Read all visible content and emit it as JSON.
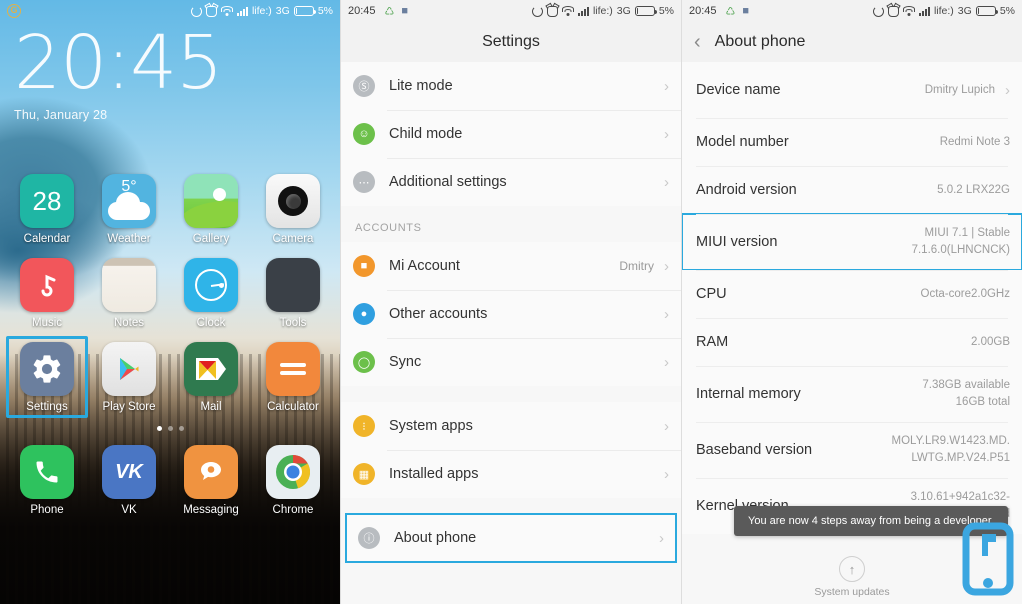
{
  "status_bar": {
    "time": "20:45",
    "carrier": "life:)",
    "network": "3G",
    "battery": "5%",
    "icons": [
      "sync-icon",
      "alarm-icon",
      "wifi-icon",
      "signal-icon",
      "battery-icon"
    ],
    "left_icons_home": [
      "g-badge-icon"
    ],
    "left_icons_settings": [
      "sync-small-icon",
      "screenshot-icon"
    ]
  },
  "home": {
    "clock": "20:45",
    "date": "Thu, January 28",
    "rows": [
      [
        {
          "label": "Calendar",
          "icon": "calendar-icon",
          "badge": "28"
        },
        {
          "label": "Weather",
          "icon": "weather-icon",
          "temp": "5°"
        },
        {
          "label": "Gallery",
          "icon": "gallery-icon"
        },
        {
          "label": "Camera",
          "icon": "camera-icon"
        }
      ],
      [
        {
          "label": "Music",
          "icon": "music-icon"
        },
        {
          "label": "Notes",
          "icon": "notes-icon"
        },
        {
          "label": "Clock",
          "icon": "clock-icon"
        },
        {
          "label": "Tools",
          "icon": "tools-folder-icon"
        }
      ],
      [
        {
          "label": "Settings",
          "icon": "settings-gear-icon",
          "selected": true
        },
        {
          "label": "Play Store",
          "icon": "play-store-icon"
        },
        {
          "label": "Mail",
          "icon": "mail-icon"
        },
        {
          "label": "Calculator",
          "icon": "calculator-icon"
        }
      ]
    ],
    "dock": [
      {
        "label": "Phone",
        "icon": "phone-icon"
      },
      {
        "label": "VK",
        "icon": "vk-icon",
        "glyph": "VK"
      },
      {
        "label": "Messaging",
        "icon": "messaging-icon"
      },
      {
        "label": "Chrome",
        "icon": "chrome-icon"
      }
    ],
    "page_dots": 3,
    "active_dot": 0,
    "highlight_color": "#2aa9de"
  },
  "settings": {
    "title": "Settings",
    "items_top": [
      {
        "label": "Lite mode",
        "icon": "lite-mode-icon",
        "color": "#b8bcc0"
      },
      {
        "label": "Child mode",
        "icon": "child-mode-icon",
        "color": "#6cc04a"
      },
      {
        "label": "Additional settings",
        "icon": "additional-settings-icon",
        "color": "#b8bcc0"
      }
    ],
    "section_accounts": "ACCOUNTS",
    "items_accounts": [
      {
        "label": "Mi Account",
        "icon": "mi-account-icon",
        "color": "#f2972c",
        "value": "Dmitry"
      },
      {
        "label": "Other accounts",
        "icon": "other-accounts-icon",
        "color": "#2f9fe0",
        "value": ""
      },
      {
        "label": "Sync",
        "icon": "sync-icon",
        "color": "#6cc04a",
        "value": ""
      }
    ],
    "items_apps": [
      {
        "label": "System apps",
        "icon": "system-apps-icon",
        "color": "#f0b429"
      },
      {
        "label": "Installed apps",
        "icon": "installed-apps-icon",
        "color": "#f0b429"
      }
    ],
    "about_phone": {
      "label": "About phone",
      "icon": "about-phone-icon",
      "color": "#b8bcc0",
      "highlighted": true
    }
  },
  "about": {
    "title": "About phone",
    "back": "back-chevron-icon",
    "rows": [
      {
        "label": "Device name",
        "value": "Dmitry Lupich",
        "chevron": true,
        "highlighted": false
      },
      {
        "label": "Model number",
        "value": "Redmi Note 3",
        "chevron": false,
        "highlighted": false
      },
      {
        "label": "Android version",
        "value": "5.0.2 LRX22G",
        "chevron": false,
        "highlighted": false
      },
      {
        "label": "MIUI version",
        "value": "MIUI 7.1 | Stable\n7.1.6.0(LHNCNCK)",
        "chevron": false,
        "highlighted": true
      },
      {
        "label": "CPU",
        "value": "Octa-core2.0GHz",
        "chevron": false,
        "highlighted": false
      },
      {
        "label": "RAM",
        "value": "2.00GB",
        "chevron": false,
        "highlighted": false
      },
      {
        "label": "Internal memory",
        "value": "7.38GB available\n16GB total",
        "chevron": false,
        "highlighted": false
      },
      {
        "label": "Baseband version",
        "value": "MOLY.LR9.W1423.MD.\nLWTG.MP.V24.P51",
        "chevron": false,
        "highlighted": false
      },
      {
        "label": "Kernel version",
        "value": "3.10.61+942a1c32-\n67cd",
        "chevron": false,
        "highlighted": false
      }
    ],
    "toast": "You are now 4 steps away from being a developer.",
    "system_updates": "System updates",
    "system_updates_icon": "up-arrow-icon",
    "phone_badge_icon": "phone-device-icon"
  }
}
